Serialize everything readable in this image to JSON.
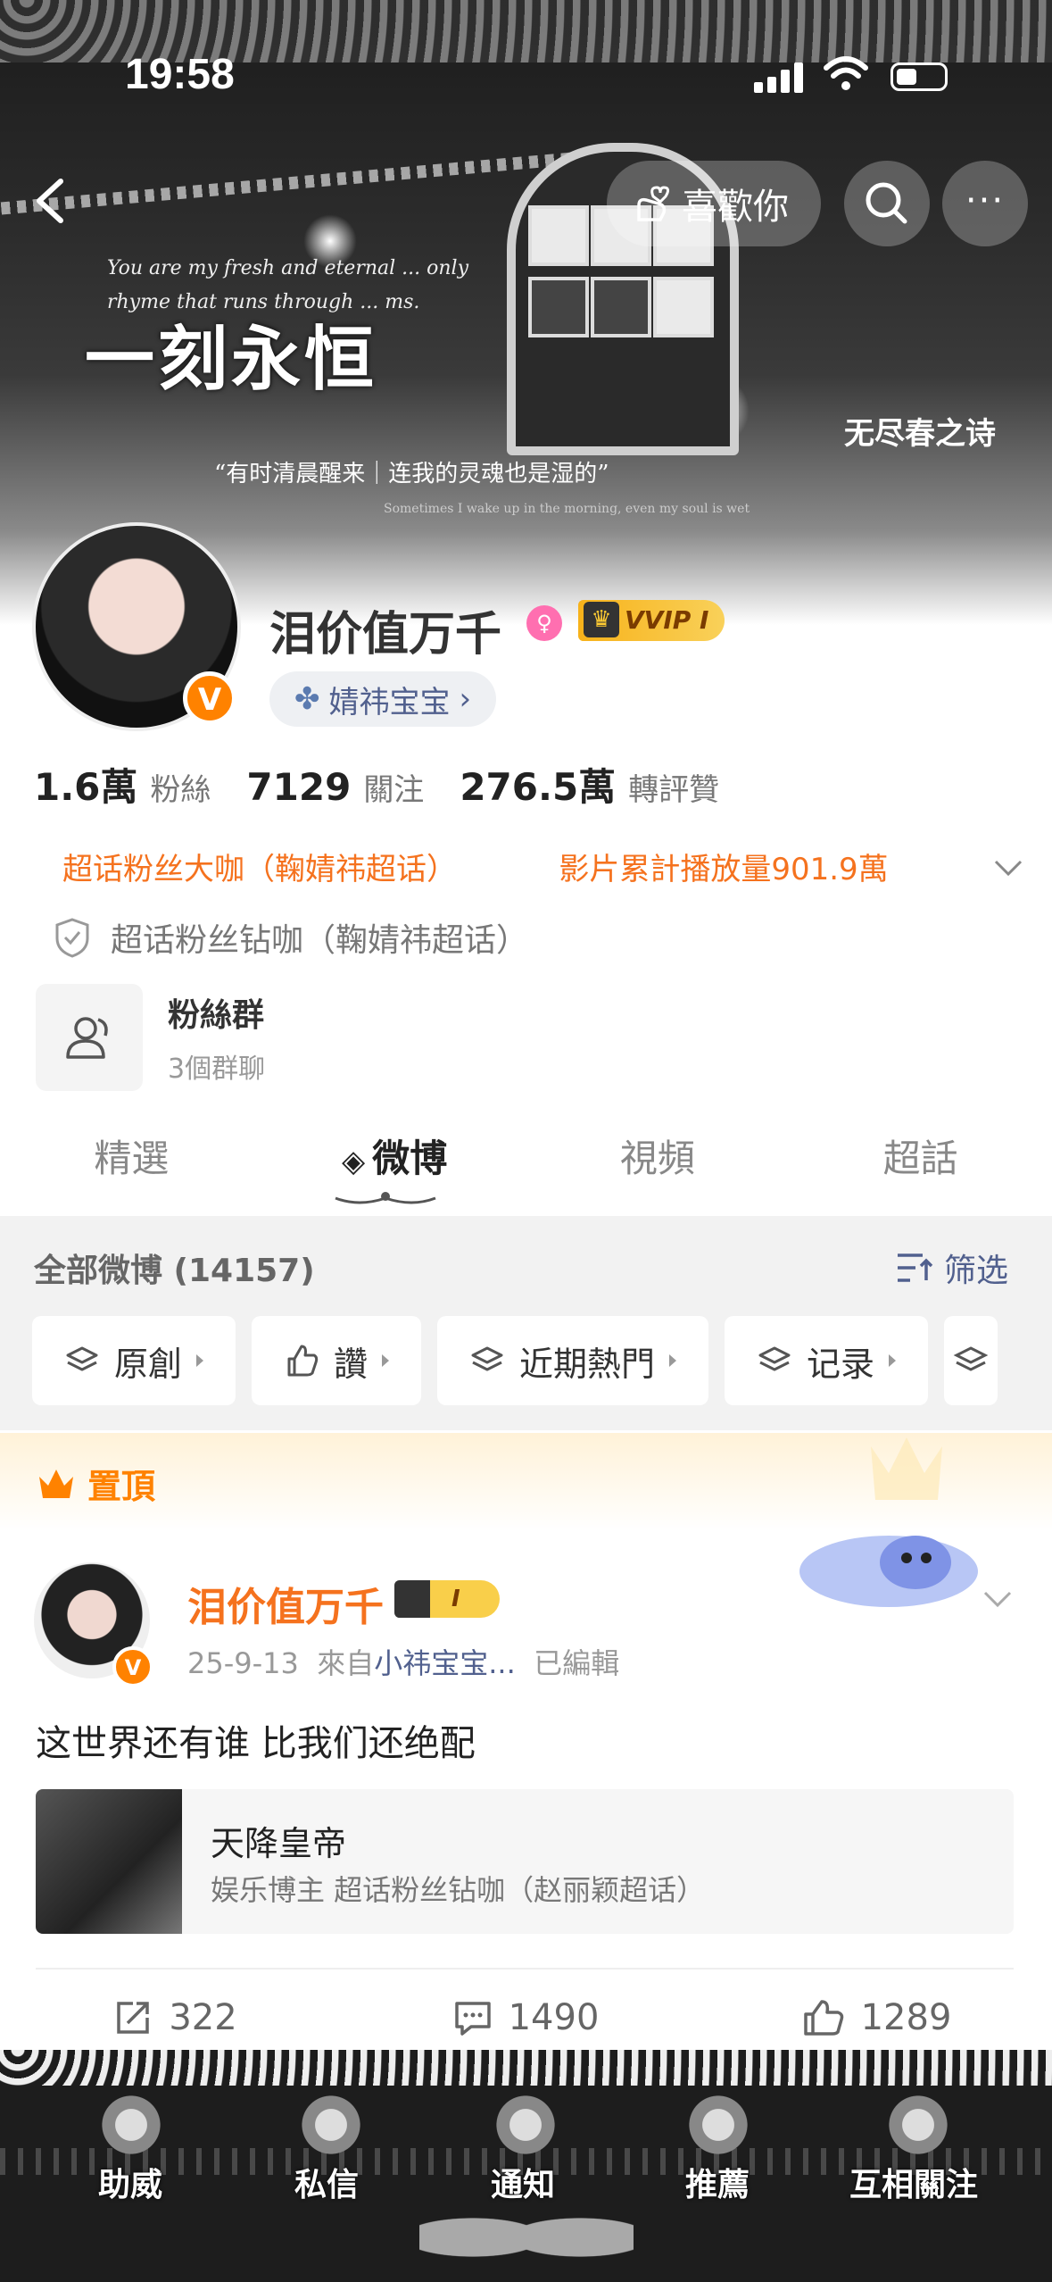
{
  "status_bar": {
    "time": "19:58"
  },
  "header": {
    "like_label": "喜歡你",
    "more_label": "···"
  },
  "banner": {
    "english_text": "You are my fresh and eternal ... only rhyme that runs through ... ms.",
    "title_text": "一刻永恒",
    "quote": "“有时清晨醒来｜连我的灵魂也是湿的”",
    "quote_sub": "Sometimes I wake up in the morning, even my soul is wet",
    "poem_label": "无尽春之诗"
  },
  "profile": {
    "username": "泪价值万千",
    "verified_mark": "V",
    "vvip_label": "VVIP I",
    "supertopic_pill": "婧祎宝宝",
    "stats": [
      {
        "value": "1.6萬",
        "label": "粉絲"
      },
      {
        "value": "7129",
        "label": "關注"
      },
      {
        "value": "276.5萬",
        "label": "轉評贊"
      }
    ],
    "badge_left": "超话粉丝大咖（鞠婧祎超话）",
    "badge_right": "影片累計播放量901.9萬",
    "shield_badge": "超话粉丝钻咖（鞠婧祎超话）",
    "fan_group": {
      "title": "粉絲群",
      "sub": "3個群聊"
    }
  },
  "tabs": [
    {
      "label": "精選",
      "active": false
    },
    {
      "label": "微博",
      "active": true
    },
    {
      "label": "視頻",
      "active": false
    },
    {
      "label": "超話",
      "active": false
    }
  ],
  "feed": {
    "all_label": "全部微博 (14157)",
    "filter_label": "筛选",
    "chips": [
      "原創",
      "讚",
      "近期熱門",
      "记录"
    ],
    "pinned_label": "置頂"
  },
  "post": {
    "author": "泪价值万千",
    "badge": "I",
    "date": "25-9-13",
    "source_prefix": "來自",
    "source": "小祎宝宝...",
    "edited": "已編輯",
    "text": "这世界还有谁 比我们还绝配",
    "card_title": "天降皇帝",
    "card_sub": "娱乐博主 超话粉丝钻咖（赵丽颖超话）",
    "reposts": "322",
    "comments": "1490",
    "likes": "1289"
  },
  "bottom_bar": [
    "助威",
    "私信",
    "通知",
    "推薦",
    "互相關注"
  ],
  "colors": {
    "accent": "#ff8200",
    "link": "#51608e",
    "badge_orange": "#f5721e"
  }
}
